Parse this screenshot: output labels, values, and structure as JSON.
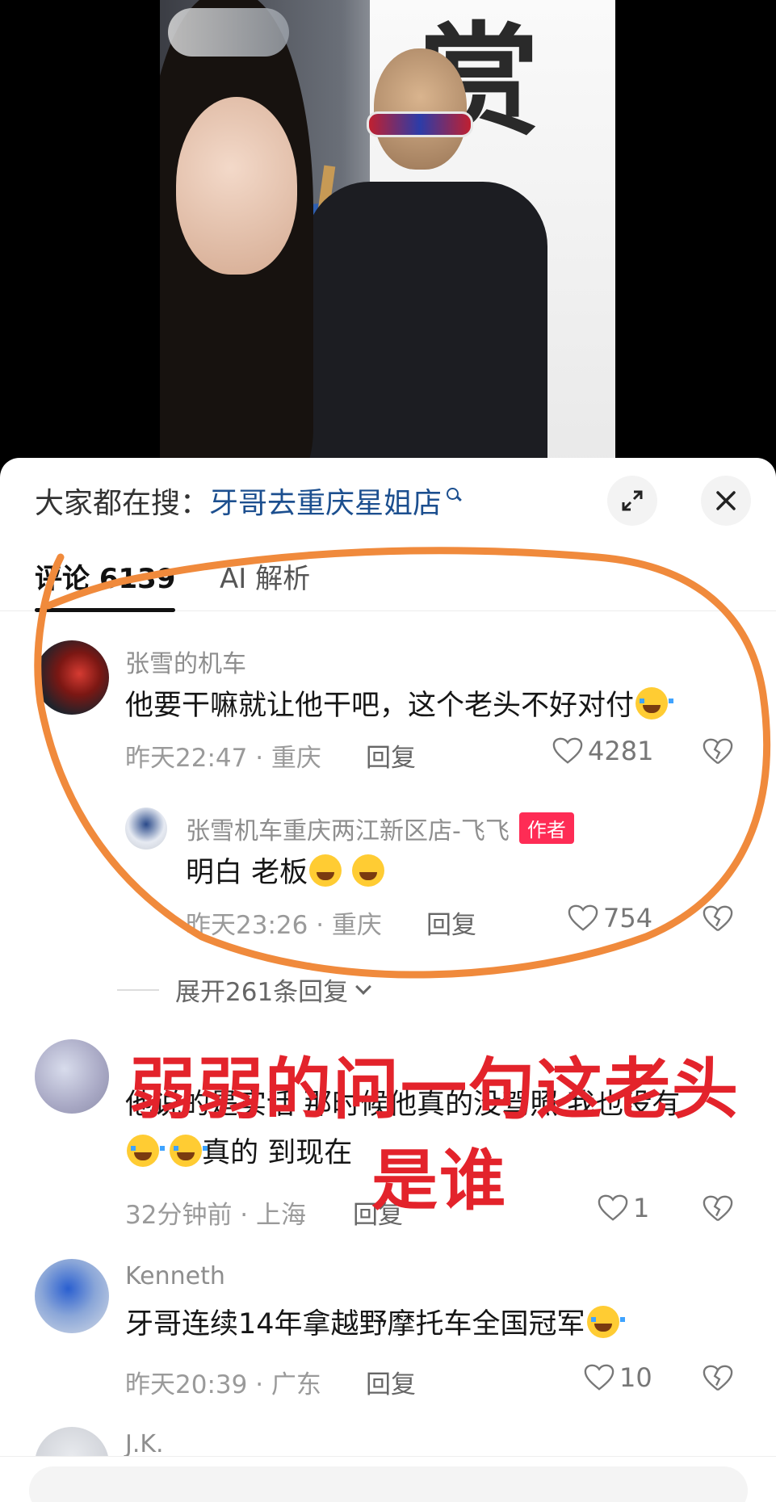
{
  "search": {
    "prefix": "大家都在搜：",
    "term": "牙哥去重庆星姐店"
  },
  "tabs": [
    {
      "label": "评论 6139"
    },
    {
      "label": "AI 解析"
    }
  ],
  "comments": [
    {
      "name": "张雪的机车",
      "text": "他要干嘛就让他干吧，这个老头不好对付",
      "time_location": "昨天22:47 · 重庆",
      "reply": "回复",
      "likes": "4281"
    },
    {
      "name": "张雪机车重庆两江新区店-飞飞",
      "badge": "作者",
      "text": "明白  老板",
      "time_location": "昨天23:26 · 重庆",
      "reply": "回复",
      "likes": "754"
    },
    {
      "text": "他说的是实话 那时候他真的没驾照 我也没有",
      "text2": "真的 到现在",
      "time_location": "32分钟前 · 上海",
      "reply": "回复",
      "likes": "1"
    },
    {
      "name": "Kenneth",
      "text": "牙哥连续14年拿越野摩托车全国冠军",
      "time_location": "昨天20:39 · 广东",
      "reply": "回复",
      "likes": "10"
    },
    {
      "name": "J.K."
    }
  ],
  "expand_replies": "展开261条回复",
  "caption": {
    "line1": "弱弱的问一句这老头",
    "line2": "是谁"
  },
  "colors": {
    "annotation_orange": "#f08a3c",
    "caption_red": "#e3232b",
    "search_blue": "#1c4f8f",
    "badge_red": "#fe2c55"
  }
}
